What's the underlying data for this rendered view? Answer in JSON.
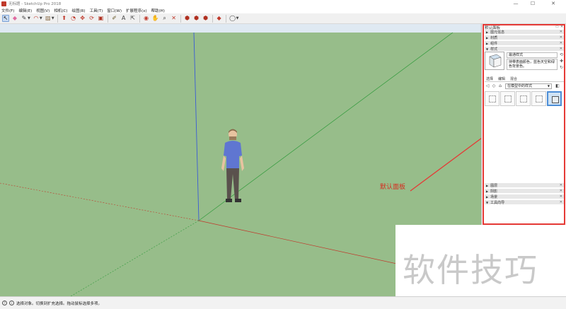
{
  "window": {
    "title": "无标题 - SketchUp Pro 2018",
    "minimize": "—",
    "maximize": "☐",
    "close": "✕"
  },
  "menu": {
    "items": [
      "文件(F)",
      "编辑(E)",
      "视图(V)",
      "相机(C)",
      "绘图(R)",
      "工具(T)",
      "窗口(W)",
      "扩展程序(x)",
      "帮助(H)"
    ]
  },
  "toolbar": {
    "tools": [
      {
        "name": "select-tool-icon",
        "glyph": "↖",
        "color": "#222222",
        "selected": true
      },
      {
        "name": "eraser-tool-icon",
        "glyph": "◆",
        "color": "#e06aa0"
      },
      {
        "name": "line-tool-icon",
        "glyph": "✎",
        "color": "#444444",
        "dropdown": true
      },
      {
        "name": "arc-tool-icon",
        "glyph": "◠",
        "color": "#c0392b",
        "dropdown": true
      },
      {
        "name": "rectangle-tool-icon",
        "glyph": "▨",
        "color": "#8a6d4a",
        "dropdown": true
      },
      {
        "name": "push-pull-tool-icon",
        "glyph": "⬆",
        "color": "#c0392b"
      },
      {
        "name": "offset-tool-icon",
        "glyph": "◔",
        "color": "#c0392b"
      },
      {
        "name": "move-tool-icon",
        "glyph": "✥",
        "color": "#c0392b"
      },
      {
        "name": "rotate-tool-icon",
        "glyph": "⟳",
        "color": "#c0392b"
      },
      {
        "name": "scale-tool-icon",
        "glyph": "▣",
        "color": "#b03020"
      },
      {
        "name": "tape-measure-tool-icon",
        "glyph": "✐",
        "color": "#6b5a2a"
      },
      {
        "name": "text-tool-icon",
        "glyph": "A",
        "color": "#444444"
      },
      {
        "name": "dimension-tool-icon",
        "glyph": "⇱",
        "color": "#444444"
      },
      {
        "name": "orbit-tool-icon",
        "glyph": "◉",
        "color": "#c0392b"
      },
      {
        "name": "pan-tool-icon",
        "glyph": "✋",
        "color": "#b08a50"
      },
      {
        "name": "zoom-tool-icon",
        "glyph": "⌕",
        "color": "#333333"
      },
      {
        "name": "zoom-extents-tool-icon",
        "glyph": "✕",
        "color": "#c0392b"
      },
      {
        "name": "3d-warehouse-icon",
        "glyph": "⬢",
        "color": "#b03020"
      },
      {
        "name": "extension-warehouse-icon",
        "glyph": "⬢",
        "color": "#b03020"
      },
      {
        "name": "layout-icon",
        "glyph": "⬢",
        "color": "#b03020"
      },
      {
        "name": "ruby-console-icon",
        "glyph": "◆",
        "color": "#c0392b"
      },
      {
        "name": "account-icon",
        "glyph": "◯",
        "color": "#444444",
        "dropdown": true
      }
    ]
  },
  "viewport": {
    "annotation": "默认面板",
    "sky_color": "#dfe9f2",
    "ground_color": "#97bd8a"
  },
  "tray": {
    "title": "默认面板",
    "sections_top": [
      {
        "label": "图元信息",
        "open": false
      },
      {
        "label": "材质",
        "open": false
      },
      {
        "label": "组件",
        "open": false
      },
      {
        "label": "样式",
        "open": true
      }
    ],
    "style": {
      "name": "最通样式",
      "description": "持带表面颜色，蓝色天空和绿色背景色。"
    },
    "subtabs": [
      "选择",
      "编辑",
      "混合"
    ],
    "select_value": "在模型中的样式",
    "sections_bottom": [
      {
        "label": "图层",
        "open": false
      },
      {
        "label": "阴影",
        "open": false
      },
      {
        "label": "场景",
        "open": false
      },
      {
        "label": "工具向导",
        "open": true
      }
    ]
  },
  "watermark": {
    "text": "软件技巧"
  },
  "status": {
    "text": "选择对象。切换到扩充选择。拖动鼠标选择多项。"
  }
}
